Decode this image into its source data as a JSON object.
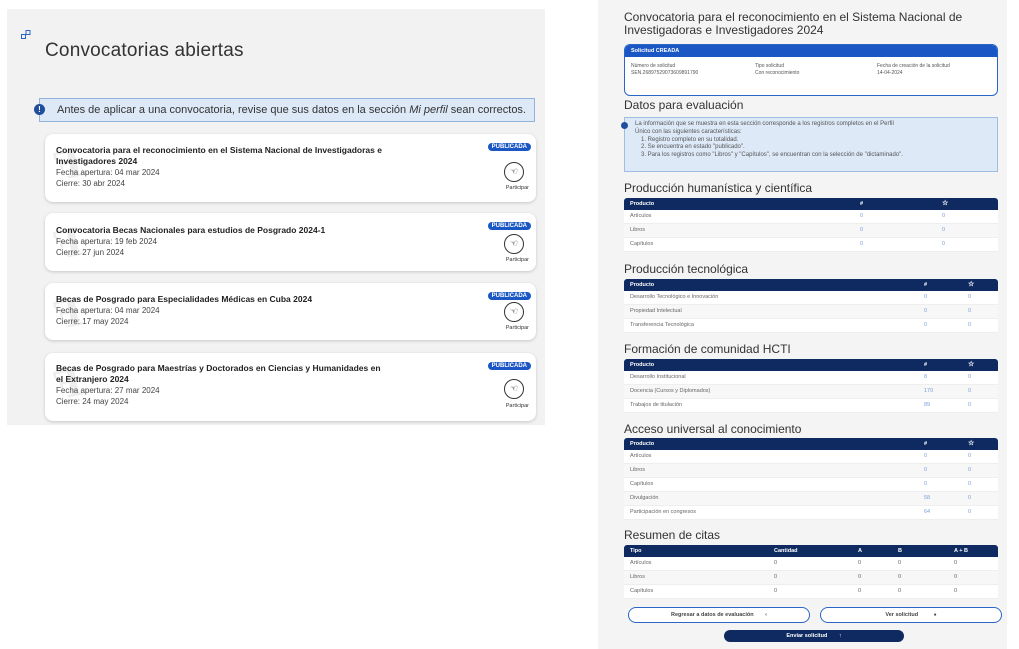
{
  "left": {
    "title": "Convocatorias abiertas",
    "alert": {
      "text_before": "Antes de aplicar a una convocatoria, revise que sus datos en la sección ",
      "text_italic": "Mi perfil",
      "text_after": " sean correctos."
    },
    "participate_label": "Participar",
    "cards": [
      {
        "title": "Convocatoria para el reconocimiento en el Sistema Nacional de Investigadoras e Investigadores 2024",
        "opening": "Fecha apertura: 04 mar 2024",
        "closing": "Cierre: 30 abr 2024",
        "badge": "PUBLICADA"
      },
      {
        "title": "Convocatoria Becas Nacionales para estudios de Posgrado 2024-1",
        "opening": "Fecha apertura: 19 feb 2024",
        "closing": "Cierre: 27 jun 2024",
        "badge": "PUBLICADA"
      },
      {
        "title": "Becas de Posgrado para Especialidades Médicas en Cuba 2024",
        "opening": "Fecha apertura: 04 mar 2024",
        "closing": "Cierre: 17 may 2024",
        "badge": "PUBLICADA"
      },
      {
        "title": "Becas de Posgrado para Maestrías y Doctorados en Ciencias y Humanidades en el Extranjero 2024",
        "opening": "Fecha apertura: 27 mar 2024",
        "closing": "Cierre: 24 may 2024",
        "badge": "PUBLICADA"
      }
    ]
  },
  "right": {
    "title": "Convocatoria para el reconocimiento en el Sistema Nacional de Investigadoras e Investigadores 2024",
    "request": {
      "header": "Solicitud CREADA",
      "number_label": "Número de solicitud",
      "number_value": "SEN.26897529073609891790",
      "type_label": "Tipo solicitud",
      "type_value": "Con reconocimiento",
      "date_label": "Fecha de creación de la solicitud",
      "date_value": "14-04-2024"
    },
    "eval_title": "Datos para evaluación",
    "eval_info": [
      "La información que se muestra en esta sección corresponde a los registros completos en el Perfil",
      "Único con las siguientes características:",
      "1. Registro completo en su totalidad.",
      "2. Se encuentra en estado \"publicado\".",
      "3. Para los registros como \"Libros\" y \"Capítulos\", se encuentran con la selección de \"dictaminado\"."
    ],
    "sections": [
      {
        "title": "Producción humanística y científica",
        "col_product": "Producto",
        "col_count": "#",
        "col_star": "☆",
        "rows": [
          [
            "Artículos",
            "0",
            "0"
          ],
          [
            "Libros",
            "0",
            "0"
          ],
          [
            "Capítulos",
            "0",
            "0"
          ]
        ]
      },
      {
        "title": "Producción tecnológica",
        "col_product": "Producto",
        "col_count": "#",
        "col_star": "☆",
        "rows": [
          [
            "Desarrollo Tecnológico e Innovación",
            "0",
            "0"
          ],
          [
            "Propiedad Intelectual",
            "0",
            "0"
          ],
          [
            "Transferencia Tecnológica",
            "0",
            "0"
          ]
        ]
      },
      {
        "title": "Formación de comunidad HCTI",
        "col_product": "Producto",
        "col_count": "#",
        "col_star": "☆",
        "rows": [
          [
            "Desarrollo Institucional",
            "8",
            "0"
          ],
          [
            "Docencia (Cursos y Diplomados)",
            "170",
            "0"
          ],
          [
            "Trabajos de titulación",
            "89",
            "0"
          ]
        ]
      },
      {
        "title": "Acceso universal al conocimiento",
        "col_product": "Producto",
        "col_count": "#",
        "col_star": "☆",
        "rows": [
          [
            "Artículos",
            "0",
            "0"
          ],
          [
            "Libros",
            "0",
            "0"
          ],
          [
            "Capítulos",
            "0",
            "0"
          ],
          [
            "Divulgación",
            "58",
            "0"
          ],
          [
            "Participación en congresos",
            "64",
            "0"
          ]
        ]
      }
    ],
    "citations": {
      "title": "Resumen de citas",
      "headers": [
        "Tipo",
        "Cantidad",
        "A",
        "B",
        "A + B"
      ],
      "rows": [
        [
          "Artículos",
          "0",
          "0",
          "0",
          "0"
        ],
        [
          "Libros",
          "0",
          "0",
          "0",
          "0"
        ],
        [
          "Capítulos",
          "0",
          "0",
          "0",
          "0"
        ]
      ]
    },
    "buttons": {
      "back": "Regresar a datos de evaluación",
      "back_icon": "‹",
      "view": "Ver solicitud",
      "view_icon": "●",
      "send": "Enviar solicitud",
      "send_icon": "↑"
    }
  }
}
